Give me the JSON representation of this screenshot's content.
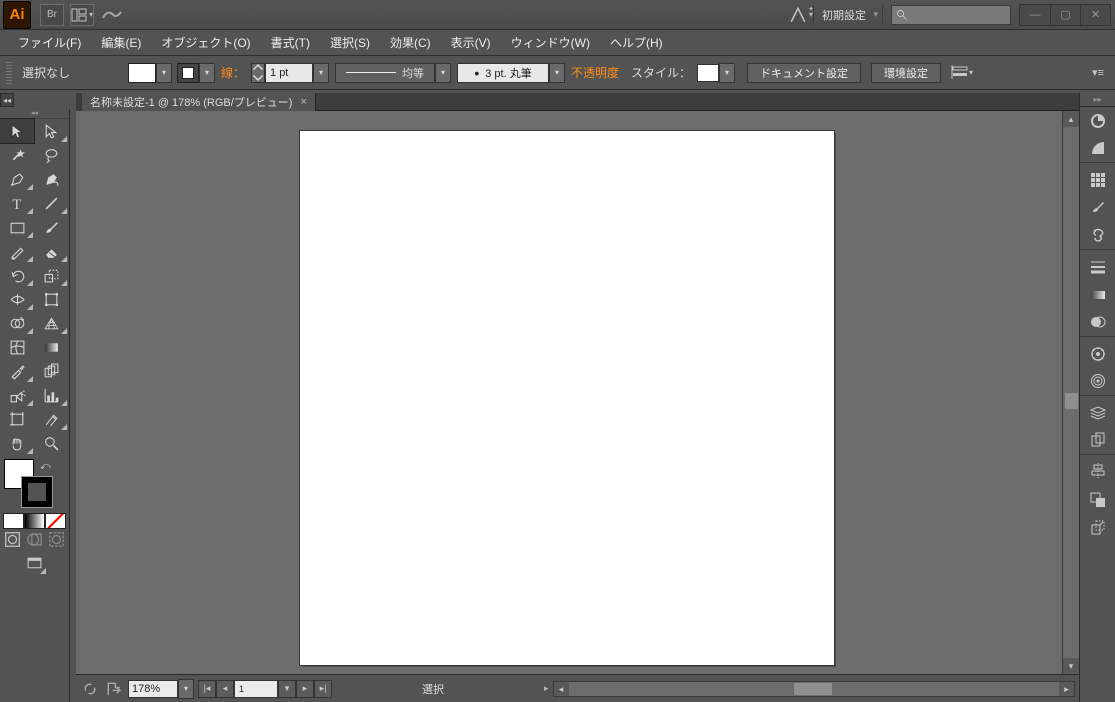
{
  "app": {
    "logo": "Ai",
    "bridge": "Br"
  },
  "workspace": "初期設定",
  "search_placeholder": "",
  "menu": [
    "ファイル(F)",
    "編集(E)",
    "オブジェクト(O)",
    "書式(T)",
    "選択(S)",
    "効果(C)",
    "表示(V)",
    "ウィンドウ(W)",
    "ヘルプ(H)"
  ],
  "ctrl": {
    "selection": "選択なし",
    "stroke_label": "線：",
    "stroke_weight": "1 pt",
    "stroke_uniform": "均等",
    "brush_label": "3 pt. 丸筆",
    "opacity": "不透明度",
    "style_label": "スタイル：",
    "doc_setup": "ドキュメント設定",
    "pref": "環境設定"
  },
  "doc_tab": {
    "title": "名称未設定-1 @ 178% (RGB/プレビュー)",
    "close": "×"
  },
  "status": {
    "zoom": "178%",
    "page": "1",
    "tool": "選択"
  },
  "right_panels": [
    "color",
    "color-guide",
    "",
    "swatches",
    "brushes",
    "symbols",
    "",
    "stroke",
    "gradient",
    "transparency",
    "",
    "appearance",
    "graphic-styles",
    "",
    "layers",
    "artboards",
    "",
    "align",
    "pathfinder",
    "transform"
  ]
}
